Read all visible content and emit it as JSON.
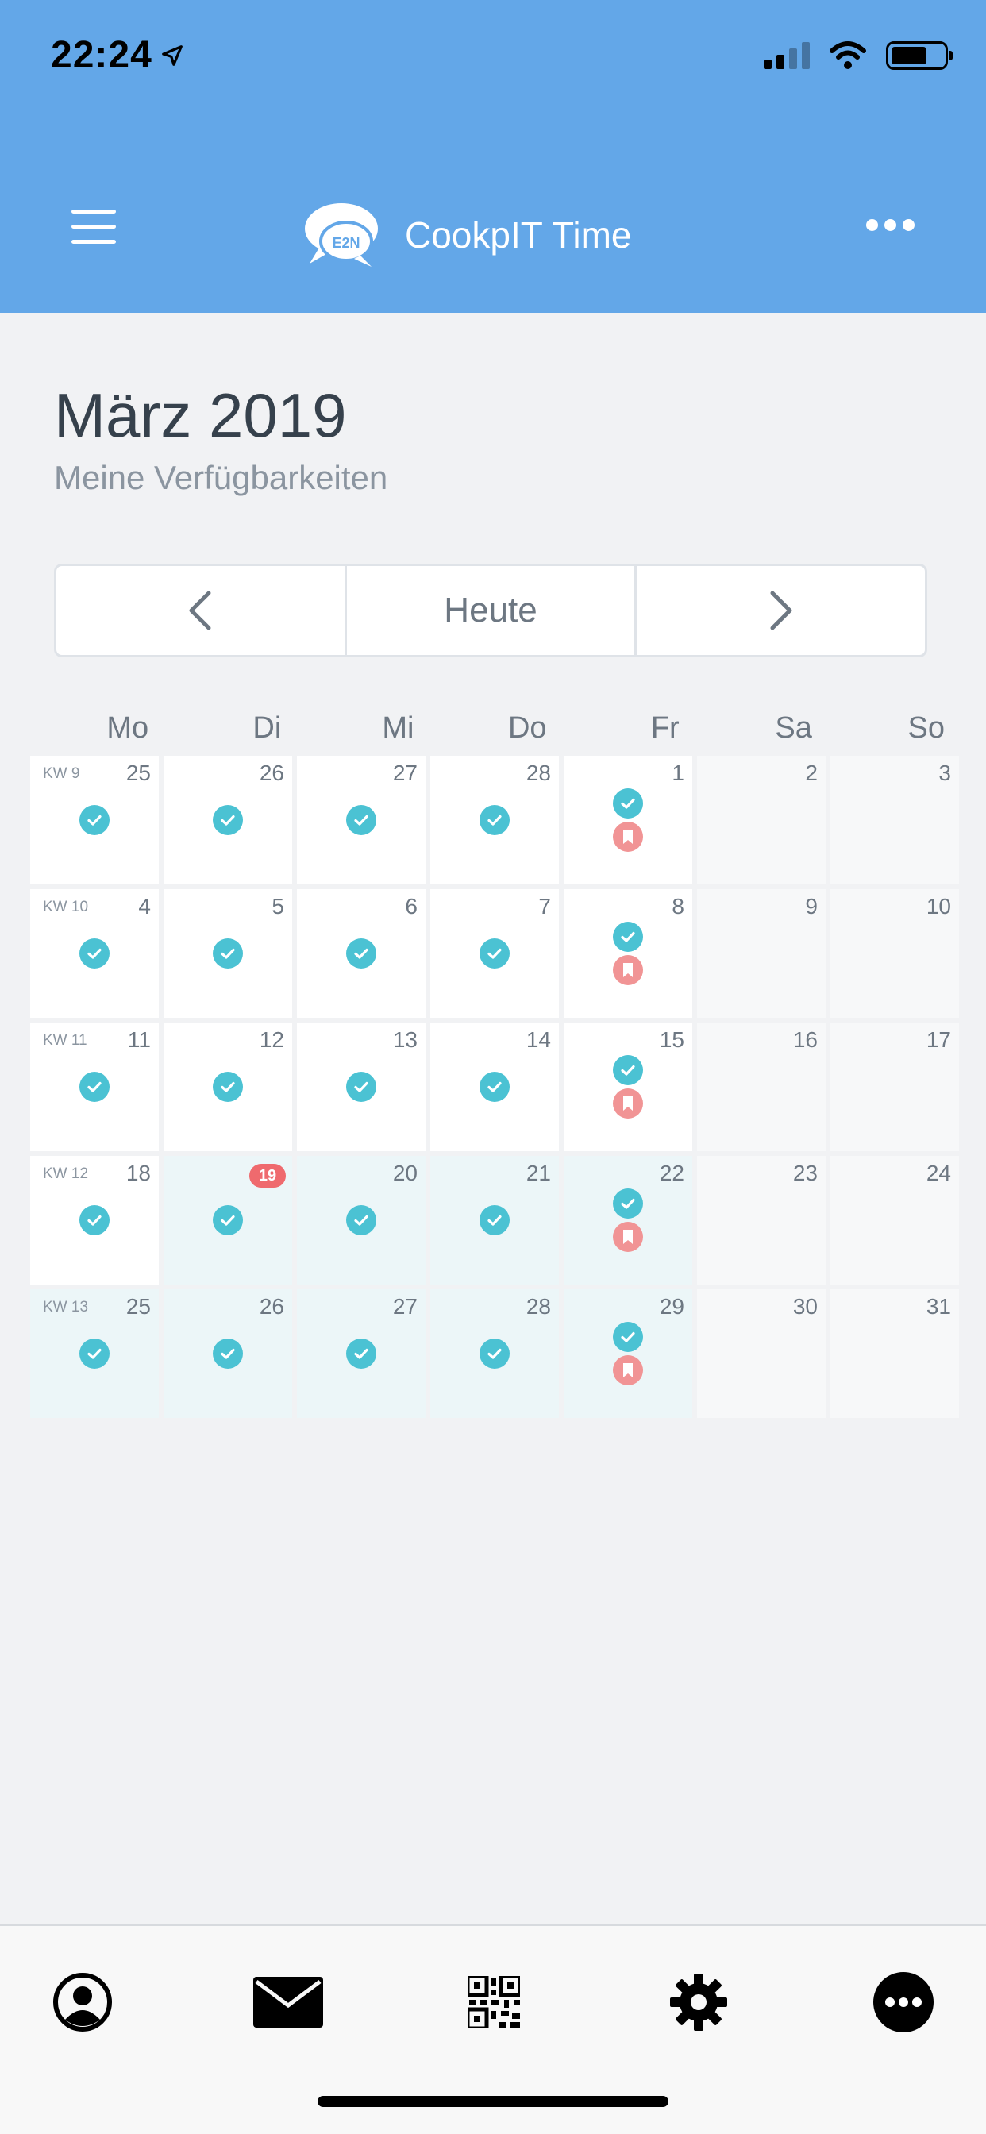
{
  "status_bar": {
    "time": "22:24"
  },
  "header": {
    "title": "CookpIT Time",
    "logo_text": "E2N"
  },
  "page": {
    "title": "März 2019",
    "subtitle": "Meine Verfügbarkeiten"
  },
  "nav": {
    "today_label": "Heute"
  },
  "weekdays": [
    "Mo",
    "Di",
    "Mi",
    "Do",
    "Fr",
    "Sa",
    "So"
  ],
  "weeks": [
    {
      "kw": "KW 9",
      "days": [
        "25",
        "26",
        "27",
        "28",
        "1",
        "2",
        "3"
      ]
    },
    {
      "kw": "KW 10",
      "days": [
        "4",
        "5",
        "6",
        "7",
        "8",
        "9",
        "10"
      ]
    },
    {
      "kw": "KW 11",
      "days": [
        "11",
        "12",
        "13",
        "14",
        "15",
        "16",
        "17"
      ]
    },
    {
      "kw": "KW 12",
      "days": [
        "18",
        "19",
        "20",
        "21",
        "22",
        "23",
        "24"
      ]
    },
    {
      "kw": "KW 13",
      "days": [
        "25",
        "26",
        "27",
        "28",
        "29",
        "30",
        "31"
      ]
    }
  ],
  "today": "19",
  "colors": {
    "header_bg": "#63a7e8",
    "available": "#4bc2d3",
    "booked": "#f19495",
    "today_badge": "#ef6a6e"
  },
  "tabbar": {
    "items": [
      "profile-icon",
      "mail-icon",
      "qr-code-icon",
      "settings-icon",
      "more-icon"
    ]
  }
}
